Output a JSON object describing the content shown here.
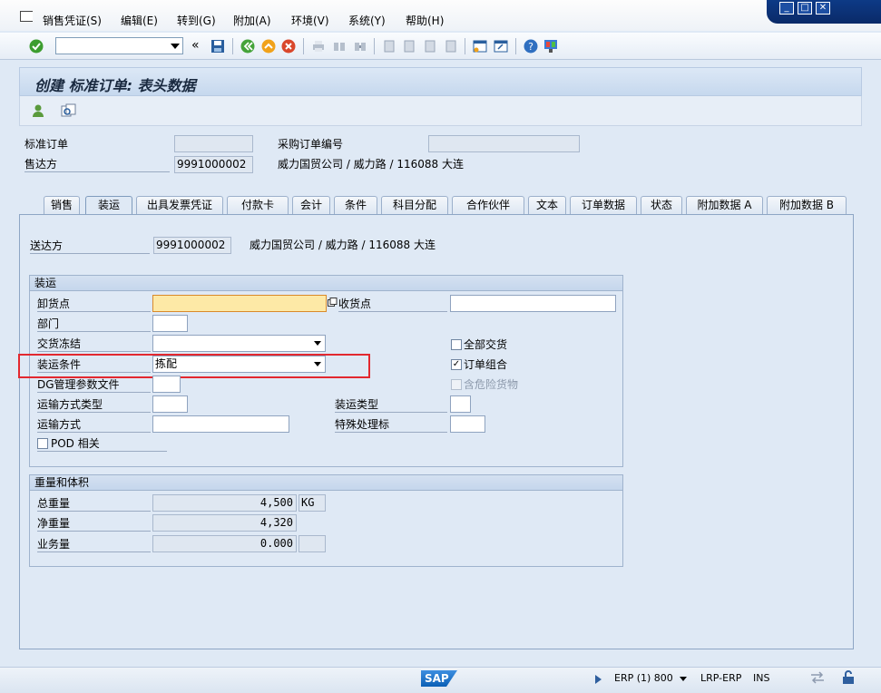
{
  "menu": {
    "items": [
      "销售凭证(S)",
      "编辑(E)",
      "转到(G)",
      "附加(A)",
      "环境(V)",
      "系统(Y)",
      "帮助(H)"
    ]
  },
  "toolbar": {
    "command_value": "",
    "icons": [
      "check-icon",
      "save-icon",
      "back-icon",
      "exit-icon",
      "cancel-icon",
      "print-icon",
      "find-icon",
      "find-next-icon",
      "first-page-icon",
      "prev-page-icon",
      "next-page-icon",
      "last-page-icon",
      "new-session-icon",
      "shortcut-icon",
      "help-icon",
      "layout-icon"
    ]
  },
  "title": "创建 标准订单: 表头数据",
  "header": {
    "order_type_label": "标准订单",
    "order_type_value": "",
    "po_number_label": "采购订单编号",
    "po_number_value": "",
    "sold_to_label": "售达方",
    "sold_to_value": "9991000002",
    "sold_to_desc": "威力国贸公司 / 威力路 / 116088 大连"
  },
  "tabs": [
    "销售",
    "装运",
    "出具发票凭证",
    "付款卡",
    "会计",
    "条件",
    "科目分配",
    "合作伙伴",
    "文本",
    "订单数据",
    "状态",
    "附加数据 A",
    "附加数据 B"
  ],
  "active_tab": "装运",
  "ship_to": {
    "label": "送达方",
    "value": "9991000002",
    "desc": "威力国贸公司 / 威力路 / 116088 大连"
  },
  "shipping": {
    "title": "装运",
    "unloading_point_label": "卸货点",
    "unloading_point_value": "",
    "receiving_point_label": "收货点",
    "receiving_point_value": "",
    "department_label": "部门",
    "department_value": "",
    "delivery_block_label": "交货冻结",
    "delivery_block_value": "",
    "complete_delivery_label": "全部交货",
    "complete_delivery_checked": false,
    "shipping_condition_label": "装运条件",
    "shipping_condition_value": "拣配",
    "order_combination_label": "订单组合",
    "order_combination_checked": true,
    "dg_profile_label": "DG管理参数文件",
    "dg_profile_value": "",
    "hazardous_label": "含危险货物",
    "transport_type_label": "运输方式类型",
    "transport_type_value": "",
    "shipping_type_label": "装运类型",
    "shipping_type_value": "",
    "transport_mode_label": "运输方式",
    "transport_mode_value": "",
    "special_processing_label": "特殊处理标",
    "special_processing_value": "",
    "pod_label": "POD 相关"
  },
  "weights": {
    "title": "重量和体积",
    "gross_label": "总重量",
    "gross_value": "4,500",
    "gross_unit": "KG",
    "net_label": "净重量",
    "net_value": "4,320",
    "volume_label": "业务量",
    "volume_value": "0.000",
    "volume_unit": ""
  },
  "status": {
    "logo": "SAP",
    "system": "ERP (1) 800",
    "server": "LRP-ERP",
    "mode": "INS"
  }
}
